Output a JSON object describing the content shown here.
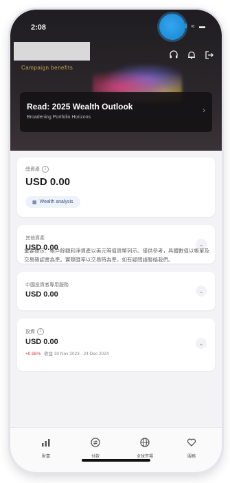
{
  "status_bar": {
    "time": "2:08",
    "icons": "•ıl ≈ ▬"
  },
  "hero": {
    "campaign_label": "Campaign benefits",
    "banner_title": "Read: 2025 Wealth Outlook",
    "banner_subtitle": "Broadening Portfolio Horizons",
    "icons": [
      "headset-icon",
      "bell-icon",
      "logout-icon"
    ]
  },
  "cards": {
    "total": {
      "label": "總資產",
      "amount": "USD 0.00",
      "chip": "Wealth analysis"
    },
    "card2": {
      "label": "其他資產",
      "amount": "USD 0.00"
    },
    "card3": {
      "label": "中國投資者專用服務",
      "amount": "USD 0.00"
    },
    "card4": {
      "label": "投資",
      "amount": "USD 0.00",
      "pct": "+0.98%",
      "date_range": "收益 30 Nov 2023 - 24 Dec 2024"
    }
  },
  "disclaimer": "重要提示：帳戶餘額和淨資產以美元等值貨幣列示。僅供參考，具體數值以帳單及交易確認書為準。實際匯率以交易時為準，如有疑問請聯絡我們。",
  "tabbar": {
    "tabs": [
      {
        "label": "財富",
        "icon": "chart-icon"
      },
      {
        "label": "付款",
        "icon": "transfer-icon"
      },
      {
        "label": "全球市場",
        "icon": "globe-icon"
      },
      {
        "label": "服務",
        "icon": "heart-icon"
      }
    ]
  },
  "colors": {
    "accent_blue": "#2a9be4",
    "hero_bg": "#1f1d21",
    "negative": "#cc3a3a"
  }
}
